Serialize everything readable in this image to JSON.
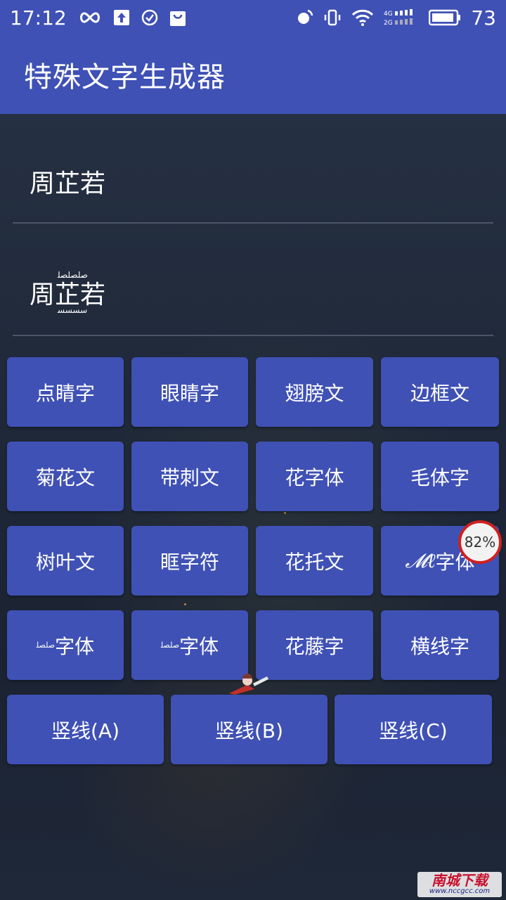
{
  "status_bar": {
    "time": "17:12",
    "battery": "73",
    "icons": [
      "infinity-icon",
      "upload-icon",
      "check-circle-icon",
      "bag-icon",
      "alarm-icon",
      "vibrate-icon",
      "wifi-icon",
      "signal-icon",
      "battery-icon"
    ]
  },
  "app": {
    "title": "特殊文字生成器"
  },
  "input": {
    "value": "周芷若"
  },
  "output": {
    "value": "周芷若",
    "decor_top": "ﺻﻠﺼﻠﺼﻠ",
    "decor_bottom": "ﺳﺴﺴﺴ"
  },
  "buttons": {
    "row1": [
      "点睛字",
      "眼睛字",
      "翅膀文",
      "边框文"
    ],
    "row2": [
      "菊花文",
      "带刺文",
      "花字体",
      "毛体字"
    ],
    "row3": [
      "树叶文",
      "眶字符",
      "花托文",
      "字体"
    ],
    "row3_last_prefix": "𝓜ℓ",
    "row4": [
      "字体",
      "字体",
      "花藤字",
      "横线字"
    ],
    "row4_prefix": "ﺻﻠﺼﻠ",
    "row5": [
      "竖线(A)",
      "竖线(B)",
      "竖线(C)"
    ]
  },
  "overlay": {
    "badge_percent": "82%",
    "watermark_main": "南城下载",
    "watermark_sub": "www.nccgcc.com"
  },
  "colors": {
    "primary": "#3f51b5",
    "background": "#1f2838",
    "divider": "#4a5568",
    "badge_ring": "#d02020"
  }
}
